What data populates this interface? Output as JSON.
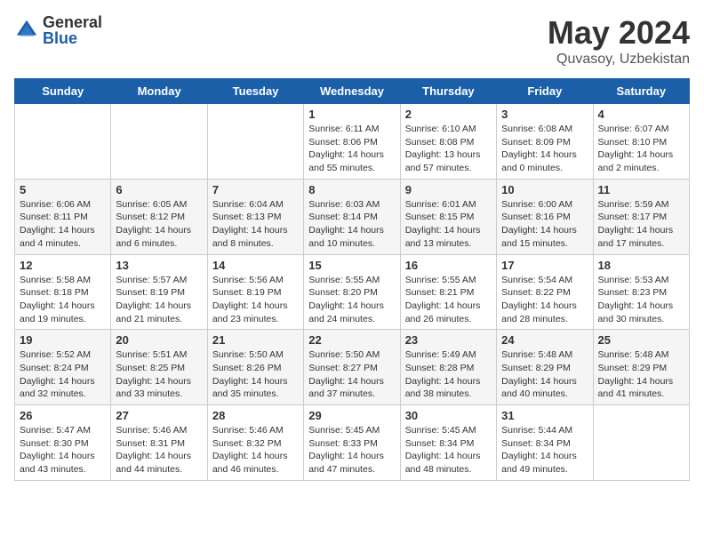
{
  "header": {
    "logo_general": "General",
    "logo_blue": "Blue",
    "month_title": "May 2024",
    "location": "Quvasoy, Uzbekistan"
  },
  "calendar": {
    "days_of_week": [
      "Sunday",
      "Monday",
      "Tuesday",
      "Wednesday",
      "Thursday",
      "Friday",
      "Saturday"
    ],
    "weeks": [
      [
        {
          "day": "",
          "info": ""
        },
        {
          "day": "",
          "info": ""
        },
        {
          "day": "",
          "info": ""
        },
        {
          "day": "1",
          "info": "Sunrise: 6:11 AM\nSunset: 8:06 PM\nDaylight: 14 hours\nand 55 minutes."
        },
        {
          "day": "2",
          "info": "Sunrise: 6:10 AM\nSunset: 8:08 PM\nDaylight: 13 hours\nand 57 minutes."
        },
        {
          "day": "3",
          "info": "Sunrise: 6:08 AM\nSunset: 8:09 PM\nDaylight: 14 hours\nand 0 minutes."
        },
        {
          "day": "4",
          "info": "Sunrise: 6:07 AM\nSunset: 8:10 PM\nDaylight: 14 hours\nand 2 minutes."
        }
      ],
      [
        {
          "day": "5",
          "info": "Sunrise: 6:06 AM\nSunset: 8:11 PM\nDaylight: 14 hours\nand 4 minutes."
        },
        {
          "day": "6",
          "info": "Sunrise: 6:05 AM\nSunset: 8:12 PM\nDaylight: 14 hours\nand 6 minutes."
        },
        {
          "day": "7",
          "info": "Sunrise: 6:04 AM\nSunset: 8:13 PM\nDaylight: 14 hours\nand 8 minutes."
        },
        {
          "day": "8",
          "info": "Sunrise: 6:03 AM\nSunset: 8:14 PM\nDaylight: 14 hours\nand 10 minutes."
        },
        {
          "day": "9",
          "info": "Sunrise: 6:01 AM\nSunset: 8:15 PM\nDaylight: 14 hours\nand 13 minutes."
        },
        {
          "day": "10",
          "info": "Sunrise: 6:00 AM\nSunset: 8:16 PM\nDaylight: 14 hours\nand 15 minutes."
        },
        {
          "day": "11",
          "info": "Sunrise: 5:59 AM\nSunset: 8:17 PM\nDaylight: 14 hours\nand 17 minutes."
        }
      ],
      [
        {
          "day": "12",
          "info": "Sunrise: 5:58 AM\nSunset: 8:18 PM\nDaylight: 14 hours\nand 19 minutes."
        },
        {
          "day": "13",
          "info": "Sunrise: 5:57 AM\nSunset: 8:19 PM\nDaylight: 14 hours\nand 21 minutes."
        },
        {
          "day": "14",
          "info": "Sunrise: 5:56 AM\nSunset: 8:19 PM\nDaylight: 14 hours\nand 23 minutes."
        },
        {
          "day": "15",
          "info": "Sunrise: 5:55 AM\nSunset: 8:20 PM\nDaylight: 14 hours\nand 24 minutes."
        },
        {
          "day": "16",
          "info": "Sunrise: 5:55 AM\nSunset: 8:21 PM\nDaylight: 14 hours\nand 26 minutes."
        },
        {
          "day": "17",
          "info": "Sunrise: 5:54 AM\nSunset: 8:22 PM\nDaylight: 14 hours\nand 28 minutes."
        },
        {
          "day": "18",
          "info": "Sunrise: 5:53 AM\nSunset: 8:23 PM\nDaylight: 14 hours\nand 30 minutes."
        }
      ],
      [
        {
          "day": "19",
          "info": "Sunrise: 5:52 AM\nSunset: 8:24 PM\nDaylight: 14 hours\nand 32 minutes."
        },
        {
          "day": "20",
          "info": "Sunrise: 5:51 AM\nSunset: 8:25 PM\nDaylight: 14 hours\nand 33 minutes."
        },
        {
          "day": "21",
          "info": "Sunrise: 5:50 AM\nSunset: 8:26 PM\nDaylight: 14 hours\nand 35 minutes."
        },
        {
          "day": "22",
          "info": "Sunrise: 5:50 AM\nSunset: 8:27 PM\nDaylight: 14 hours\nand 37 minutes."
        },
        {
          "day": "23",
          "info": "Sunrise: 5:49 AM\nSunset: 8:28 PM\nDaylight: 14 hours\nand 38 minutes."
        },
        {
          "day": "24",
          "info": "Sunrise: 5:48 AM\nSunset: 8:29 PM\nDaylight: 14 hours\nand 40 minutes."
        },
        {
          "day": "25",
          "info": "Sunrise: 5:48 AM\nSunset: 8:29 PM\nDaylight: 14 hours\nand 41 minutes."
        }
      ],
      [
        {
          "day": "26",
          "info": "Sunrise: 5:47 AM\nSunset: 8:30 PM\nDaylight: 14 hours\nand 43 minutes."
        },
        {
          "day": "27",
          "info": "Sunrise: 5:46 AM\nSunset: 8:31 PM\nDaylight: 14 hours\nand 44 minutes."
        },
        {
          "day": "28",
          "info": "Sunrise: 5:46 AM\nSunset: 8:32 PM\nDaylight: 14 hours\nand 46 minutes."
        },
        {
          "day": "29",
          "info": "Sunrise: 5:45 AM\nSunset: 8:33 PM\nDaylight: 14 hours\nand 47 minutes."
        },
        {
          "day": "30",
          "info": "Sunrise: 5:45 AM\nSunset: 8:34 PM\nDaylight: 14 hours\nand 48 minutes."
        },
        {
          "day": "31",
          "info": "Sunrise: 5:44 AM\nSunset: 8:34 PM\nDaylight: 14 hours\nand 49 minutes."
        },
        {
          "day": "",
          "info": ""
        }
      ]
    ]
  }
}
